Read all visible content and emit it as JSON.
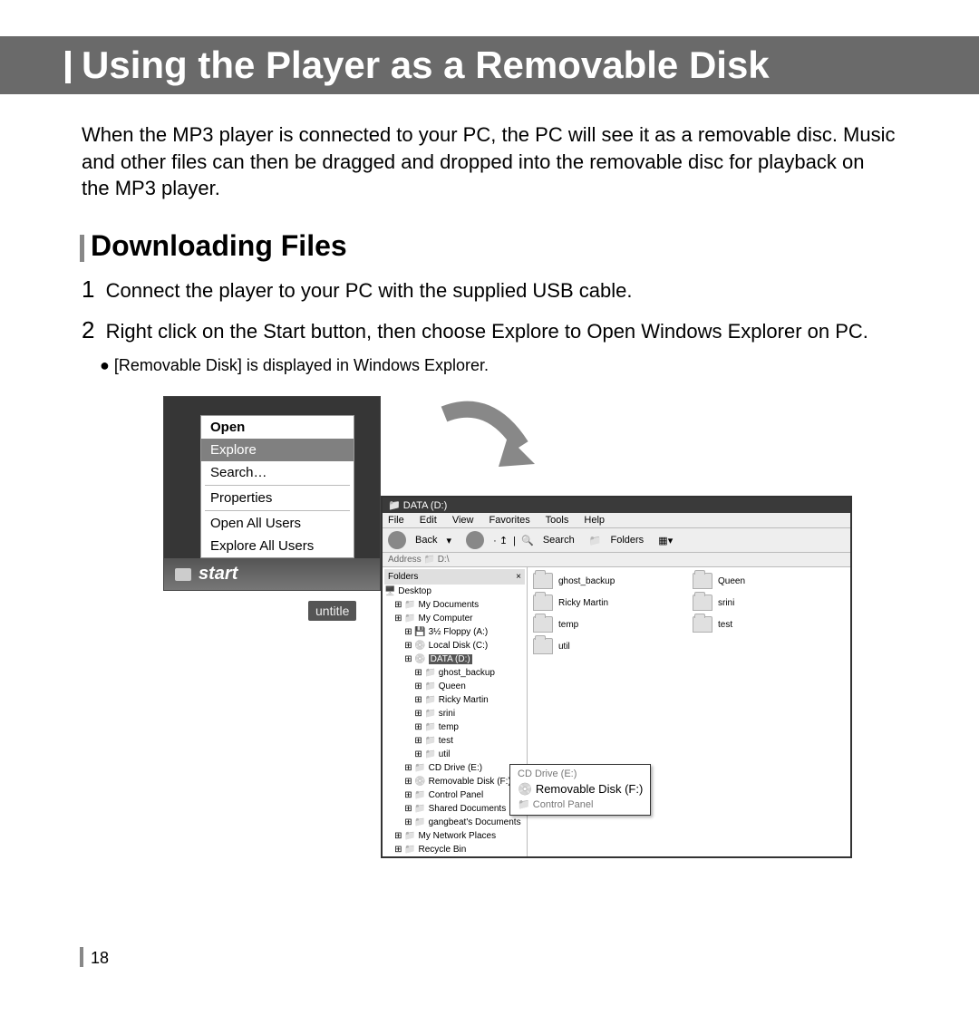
{
  "header": "Using the Player as a Removable Disk",
  "intro": "When the MP3 player is connected to your PC, the PC will see it as a removable disc. Music and other files can then be dragged and dropped into the removable disc for playback on the MP3 player.",
  "subheading": "Downloading Files",
  "steps": [
    {
      "num": "1",
      "text": "Connect the player to your PC with the supplied USB cable."
    },
    {
      "num": "2",
      "text": "Right click on the Start button, then choose Explore to Open Windows Explorer on PC."
    }
  ],
  "bullet": "[Removable Disk] is displayed in Windows Explorer.",
  "context_menu": {
    "items": [
      "Open",
      "Explore",
      "Search…",
      "Properties"
    ],
    "items2": [
      "Open All Users",
      "Explore All Users"
    ],
    "selected": "Explore"
  },
  "startbar": {
    "label": "start",
    "task": "untitle"
  },
  "explorer": {
    "title": "DATA (D:)",
    "menu": [
      "File",
      "Edit",
      "View",
      "Favorites",
      "Tools",
      "Help"
    ],
    "toolbar": {
      "back": "Back",
      "search": "Search",
      "folders": "Folders"
    },
    "address_label": "Address",
    "address_value": "D:\\",
    "tree_header": "Folders",
    "tree": [
      "Desktop",
      "  My Documents",
      "  My Computer",
      "    3½ Floppy (A:)",
      "    Local Disk (C:)",
      "    DATA (D:)",
      "      ghost_backup",
      "      Queen",
      "      Ricky Martin",
      "      srini",
      "      temp",
      "      test",
      "      util",
      "    CD Drive (E:)",
      "    Removable Disk (F:)",
      "    Control Panel",
      "    Shared Documents",
      "    gangbeat's Documents",
      "  My Network Places",
      "  Recycle Bin"
    ],
    "tree_selected": "DATA (D:)",
    "folders": [
      "ghost_backup",
      "Queen",
      "Ricky Martin",
      "srini",
      "temp",
      "test",
      "util"
    ],
    "callout": {
      "line0": "CD Drive (E:)",
      "line1": "Removable Disk (F:)",
      "line2": "Control Panel"
    }
  },
  "page_number": "18"
}
